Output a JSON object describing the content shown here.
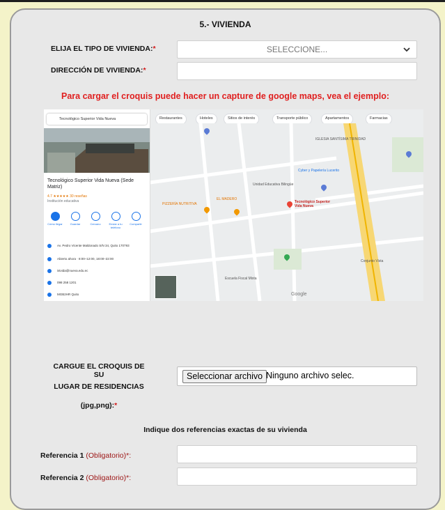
{
  "section": {
    "title": "5.-  VIVIENDA"
  },
  "tipo": {
    "label": "ELIJA EL TIPO DE VIVIENDA:",
    "required_mark": "*",
    "selected": "SELECCIONE..."
  },
  "direccion": {
    "label": "DIRECCIÓN DE VIVIENDA:",
    "required_mark": "*",
    "value": ""
  },
  "hint": "Para cargar el croquis puede hacer un capture de google maps, vea el ejemplo:",
  "map_example": {
    "search_text": "Tecnológico Superior Vida Nueva",
    "place_name": "Tecnológico Superior Vida Nueva (Sede Matriz)",
    "rating": "4.7 ★★★★★ 30 reseñas",
    "place_type": "Institución educativa",
    "actions": [
      "Cómo llegar",
      "Guardar",
      "Cercano",
      "Enviar a tu teléfono",
      "Compartir"
    ],
    "info": [
      "Av. Pedro Vicente Maldonado S/N 34, Quito 170793",
      "Abierto ahora · 8:00–12:00, 18:00–22:00",
      "istvida@nueva.edu.ec",
      "098 258 1201",
      "MGB2HR Quito"
    ],
    "chips": [
      "Restaurantes",
      "Hoteles",
      "Sitios de interés",
      "Transporte público",
      "Apartamentos",
      "Farmacias"
    ],
    "pin_label": "Tecnológico Superior Vida Nueva",
    "places": [
      "IGLESIA SANTÍSIMA TRINIDAD",
      "Cyber y Papelería Lucerito",
      "Unidad Educativa Bilingüe",
      "Conjunto Vista",
      "Escuela Fiscal Mixta",
      "PIZZERÍA NUTRITIVA",
      "EL MADERO",
      "Google"
    ]
  },
  "croquis": {
    "line1": "CARGUE EL CROQUIS DE SU",
    "line2": "LUGAR DE RESIDENCIAS",
    "line3": "(jpg,png):",
    "required_mark": "*",
    "button": "Seleccionar archivo",
    "status": "Ninguno archivo selec."
  },
  "referencias": {
    "heading": "Indique dos referencias exactas de su vivienda",
    "ref1_label": "Referencia 1 ",
    "ref2_label": "Referencia 2 ",
    "obligatorio": "(Obligatorio)",
    "required_mark": "*:",
    "ref1_value": "",
    "ref2_value": ""
  },
  "colors": {
    "required": "#d21a1a",
    "hint": "#e02020",
    "panel": "#e8e8e8",
    "page": "#f4f3c9"
  }
}
